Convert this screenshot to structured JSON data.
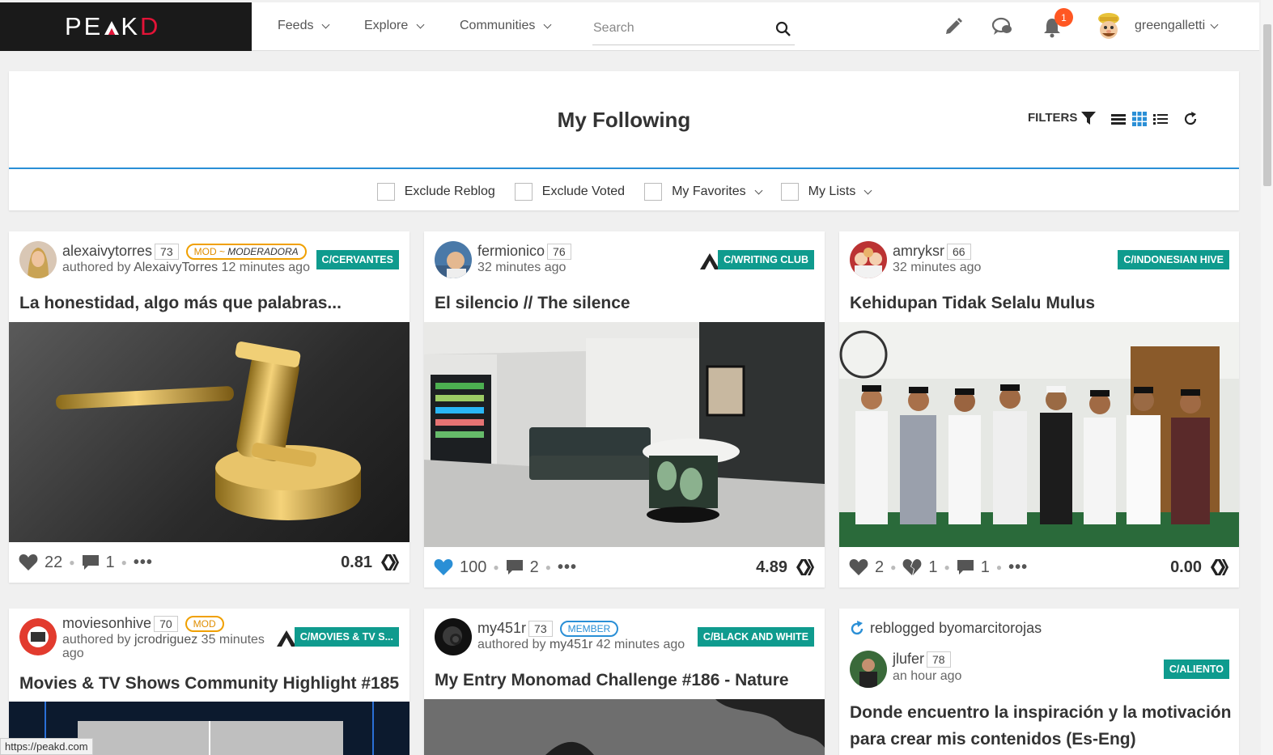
{
  "topbar": {
    "logo_pre": "PE",
    "logo_a": "A",
    "logo_k": "K",
    "logo_d": "D",
    "nav": [
      "Feeds",
      "Explore",
      "Communities"
    ],
    "search_placeholder": "Search",
    "notification_count": "1",
    "username": "greengalletti"
  },
  "header": {
    "title": "My Following",
    "filters_label": "FILTERS",
    "checks": {
      "exclude_reblog": "Exclude Reblog",
      "exclude_voted": "Exclude Voted",
      "my_favorites": "My Favorites",
      "my_lists": "My Lists"
    }
  },
  "posts": [
    {
      "author": "alexaivytorres",
      "rep": "73",
      "role_pre": "MOD ~ ",
      "role_title": "MODERADORA",
      "sub": "authored by ",
      "sub_author": "AlexaivyTorres",
      "time": " 12 minutes ago",
      "community": "C/CERVANTES",
      "title": "La honestidad, algo más que palabras...",
      "likes": "22",
      "comments": "1",
      "payout": "0.81"
    },
    {
      "author": "fermionico",
      "rep": "76",
      "time": "32 minutes ago",
      "community": "C/WRITING CLUB",
      "title": "El silencio // The silence",
      "likes": "100",
      "comments": "2",
      "payout": "4.89"
    },
    {
      "author": "amryksr",
      "rep": "66",
      "time": "32 minutes ago",
      "community": "C/INDONESIAN HIVE",
      "title": "Kehidupan Tidak Selalu Mulus",
      "likes": "2",
      "downvotes": "1",
      "comments": "1",
      "payout": "0.00"
    },
    {
      "author": "moviesonhive",
      "rep": "70",
      "role": "MOD",
      "sub": "authored by ",
      "sub_author": "jcrodriguez",
      "time": " 35 minutes",
      "time2": "ago",
      "community": "C/MOVIES & TV S...",
      "title": "Movies & TV Shows Community Highlight #185"
    },
    {
      "author": "my451r",
      "rep": "73",
      "role": "MEMBER",
      "sub": "authored by ",
      "sub_author": "my451r",
      "time": " 42 minutes ago",
      "community": "C/BLACK AND WHITE",
      "title": "My Entry Monomad Challenge #186 - Nature"
    },
    {
      "reblog_pre": "reblogged by ",
      "reblogged_by": "omarcitorojas",
      "author": "jlufer",
      "rep": "78",
      "time": "an hour ago",
      "community": "C/ALIENTO",
      "title_line1": "Donde encuentro la inspiración y la motivación",
      "title_line2": "para crear mis contenidos (Es-Eng)"
    }
  ],
  "status_url": "https://peakd.com",
  "colors": {
    "accent": "#2a8fd6",
    "community": "#0f9b8e",
    "mod": "#f0a000",
    "badge": "#ff5722",
    "logo_d": "#e31337"
  }
}
